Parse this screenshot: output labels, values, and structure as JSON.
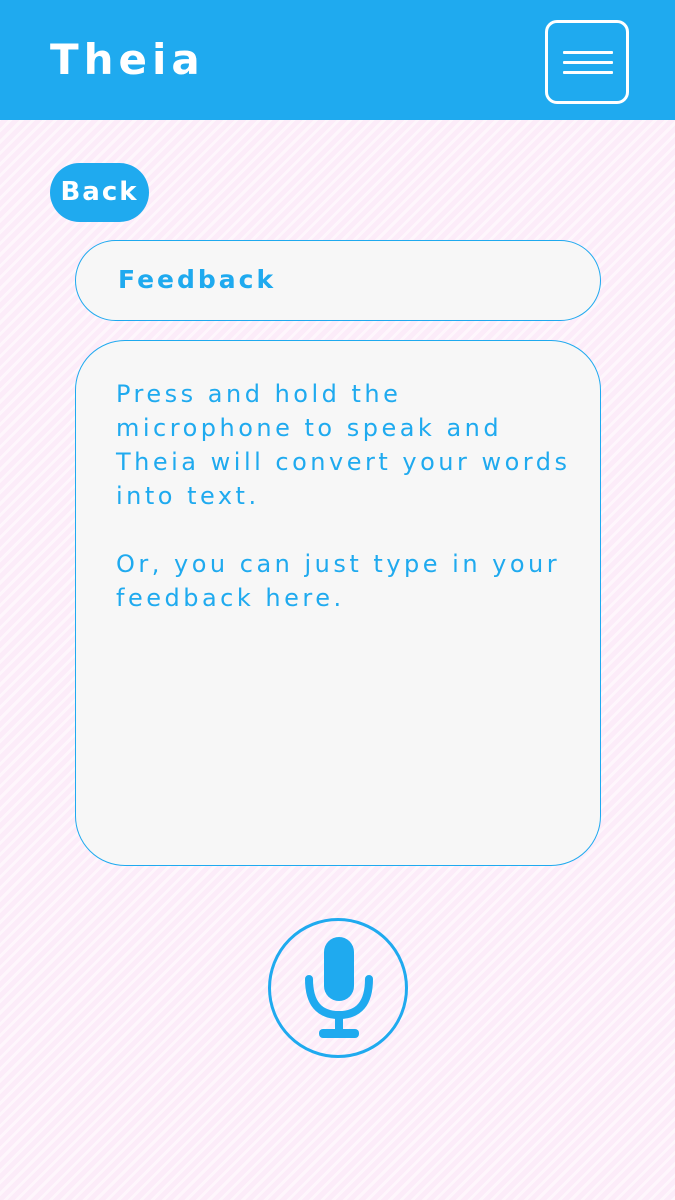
{
  "header": {
    "app_title": "Theia",
    "menu_icon": "hamburger-menu-icon",
    "background_color": "#1faaef"
  },
  "nav": {
    "back_label": "Back"
  },
  "form": {
    "subject_value": "Feedback",
    "feedback_placeholder_line1": "Press and hold the microphone to speak and Theia will convert your words into text.",
    "feedback_placeholder_line2": "Or, you can just type in your feedback here."
  },
  "voice": {
    "mic_icon": "microphone-icon"
  },
  "colors": {
    "accent": "#1faaef",
    "field_background": "#f7f7f7",
    "page_background": "#fcecf9"
  }
}
